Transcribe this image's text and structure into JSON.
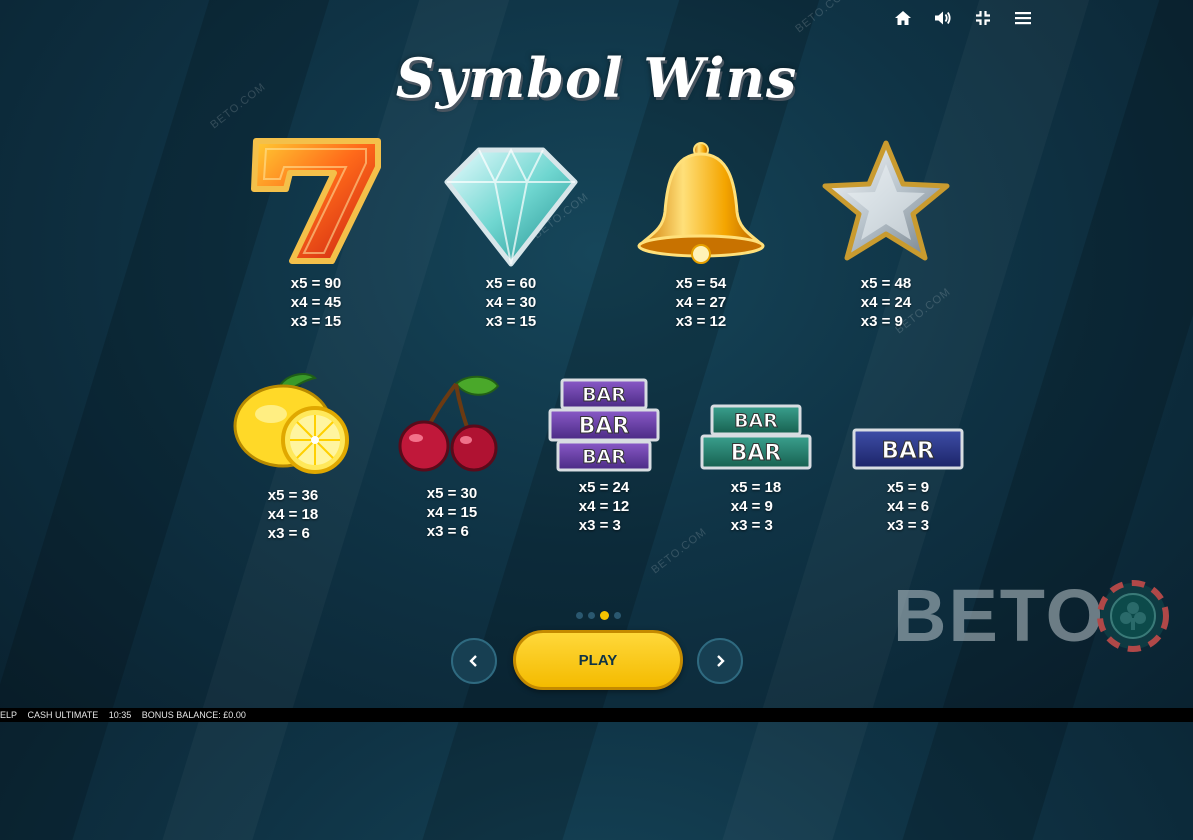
{
  "title": "Symbol Wins",
  "watermark": "BETO.COM",
  "logo_text": "BETO",
  "symbols_row1": [
    {
      "name": "seven",
      "pays": [
        "x5 = 90",
        "x4 = 45",
        "x3 = 15"
      ]
    },
    {
      "name": "diamond",
      "pays": [
        "x5 = 60",
        "x4 = 30",
        "x3 = 15"
      ]
    },
    {
      "name": "bell",
      "pays": [
        "x5 = 54",
        "x4 = 27",
        "x3 = 12"
      ]
    },
    {
      "name": "star",
      "pays": [
        "x5 = 48",
        "x4 = 24",
        "x3 = 9"
      ]
    }
  ],
  "symbols_row2": [
    {
      "name": "lemon",
      "pays": [
        "x5 = 36",
        "x4 = 18",
        "x3 = 6"
      ]
    },
    {
      "name": "cherries",
      "pays": [
        "x5 = 30",
        "x4 = 15",
        "x3 = 6"
      ]
    },
    {
      "name": "triple-bar",
      "pays": [
        "x5 = 24",
        "x4 = 12",
        "x3 = 3"
      ]
    },
    {
      "name": "double-bar",
      "pays": [
        "x5 = 18",
        "x4 = 9",
        "x3 = 3"
      ]
    },
    {
      "name": "single-bar",
      "pays": [
        "x5 = 9",
        "x4 = 6",
        "x3 = 3"
      ]
    }
  ],
  "bar_label": "BAR",
  "play_label": "PLAY",
  "pagination": {
    "total": 4,
    "active": 2
  },
  "toolbar_icons": [
    "home-icon",
    "sound-icon",
    "fullscreen-exit-icon",
    "menu-icon"
  ],
  "status_bar": {
    "help": "ELP",
    "game": "CASH ULTIMATE",
    "time": "10:35",
    "bonus_balance": "BONUS BALANCE: £0.00"
  },
  "colors": {
    "accent": "#f5c300",
    "background": "#0f3345"
  }
}
